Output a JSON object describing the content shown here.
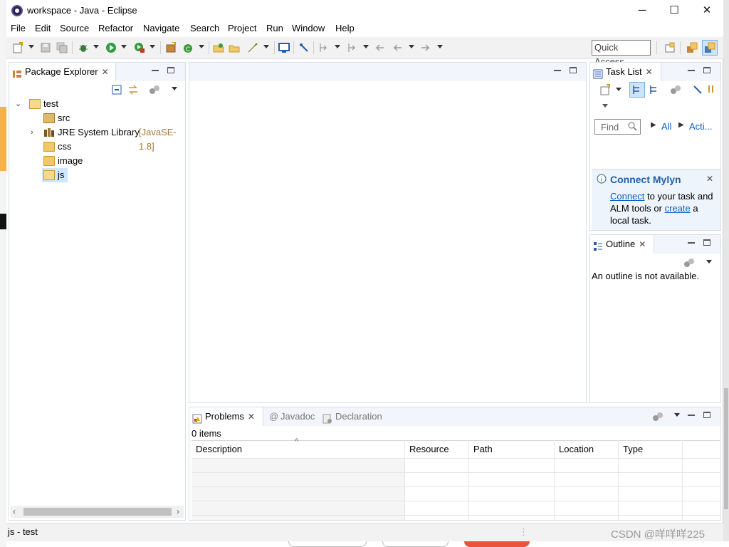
{
  "window": {
    "title": "workspace - Java - Eclipse",
    "controls": {
      "minimize": "─",
      "maximize": "☐",
      "close": "✕"
    }
  },
  "menu": [
    "File",
    "Edit",
    "Source",
    "Refactor",
    "Navigate",
    "Search",
    "Project",
    "Run",
    "Window",
    "Help"
  ],
  "toolbar": {
    "quick_access": "Quick Access"
  },
  "package_explorer": {
    "tab_label": "Package Explorer",
    "tree": [
      {
        "label": "test",
        "level": 0,
        "expanded": true
      },
      {
        "label": "src",
        "level": 1
      },
      {
        "label": "JRE System Library",
        "decoration": "[JavaSE-1.8]",
        "level": 1,
        "expanded": false
      },
      {
        "label": "css",
        "level": 1
      },
      {
        "label": "image",
        "level": 1
      },
      {
        "label": "js",
        "level": 1,
        "selected": true
      }
    ]
  },
  "task_list": {
    "tab_label": "Task List",
    "find_placeholder": "Find",
    "filter_all": "All",
    "filter_activate": "Acti..."
  },
  "mylyn": {
    "heading": "Connect Mylyn",
    "connect_link": "Connect",
    "text1": " to your task and",
    "text2": "ALM tools or ",
    "create_link": "create",
    "text3": " a",
    "text4": "local task."
  },
  "outline": {
    "tab_label": "Outline",
    "message": "An outline is not available."
  },
  "problems_area": {
    "tabs": [
      "Problems",
      "Javadoc",
      "Declaration"
    ],
    "count": "0 items",
    "columns": [
      "Description",
      "Resource",
      "Path",
      "Location",
      "Type"
    ]
  },
  "status": {
    "text": "js - test"
  },
  "watermark": "CSDN @咩咩咩225",
  "colors": {
    "accent": "#0b5fc1",
    "selection": "#cce8ff"
  }
}
